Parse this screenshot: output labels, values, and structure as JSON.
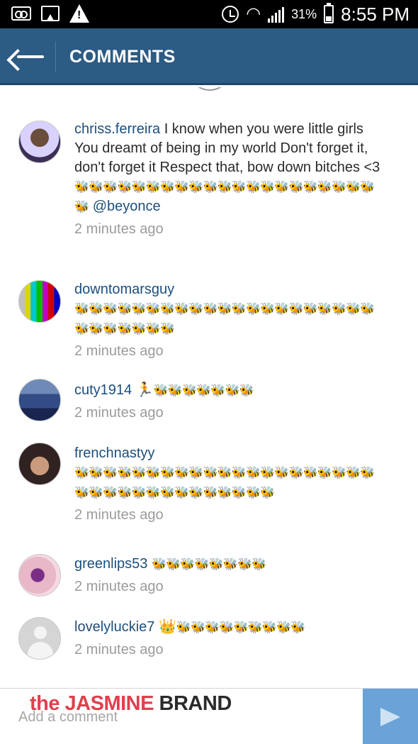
{
  "status_bar": {
    "battery_percent": "31%",
    "time": "8:55 PM",
    "icons": [
      "voicemail-icon",
      "image-icon",
      "warning-icon",
      "alarm-icon",
      "wifi-icon",
      "signal-icon",
      "battery-icon"
    ]
  },
  "header": {
    "title": "COMMENTS",
    "back_icon": "back-arrow-icon",
    "background_color": "#2c5b83"
  },
  "comments": [
    {
      "username": "chriss.ferreira",
      "text": " I know when you were little girls  You dreamt of being in my world Don't forget it, don't forget it  Respect that, bow down bitches <3",
      "emojis": "🐝🐝🐝🐝🐝🐝🐝🐝🐝🐝🐝🐝🐝🐝🐝🐝🐝🐝🐝🐝🐝🐝",
      "mention": "@beyonce",
      "time": "2 minutes ago"
    },
    {
      "username": "downtomarsguy",
      "text": "",
      "emojis": "🐝🐝🐝🐝🐝🐝🐝🐝🐝🐝🐝🐝🐝🐝🐝🐝🐝🐝🐝🐝🐝🐝🐝🐝🐝🐝🐝🐝",
      "mention": "",
      "time": "2 minutes ago"
    },
    {
      "username": "cuty1914",
      "text": " 🏃",
      "emojis": "🐝🐝🐝🐝🐝🐝🐝",
      "mention": "",
      "time": "2 minutes ago"
    },
    {
      "username": "frenchnastyy",
      "text": "",
      "emojis": "🐝🐝🐝🐝🐝🐝🐝🐝🐝🐝🐝🐝🐝🐝🐝🐝🐝🐝🐝🐝🐝🐝🐝🐝🐝🐝🐝🐝🐝🐝🐝🐝🐝🐝🐝",
      "mention": "",
      "time": "2 minutes ago"
    },
    {
      "username": "greenlips53",
      "text": " ",
      "emojis": "🐝🐝🐝🐝🐝🐝🐝🐝",
      "mention": "",
      "time": "2 minutes ago"
    },
    {
      "username": "lovelyluckie7",
      "text": " 👑",
      "emojis": "🐝🐝🐝🐝🐝🐝🐝🐝🐝",
      "mention": "",
      "time": "2 minutes ago"
    }
  ],
  "comment_input": {
    "placeholder": "Add a comment"
  },
  "send_icon": "send-icon",
  "watermark": {
    "part1": "the JASMINE",
    "part2": " BRAND"
  },
  "colors": {
    "username": "#1c4f7d",
    "timestamp": "#9b9b9b",
    "send_button": "#6aa3d8",
    "watermark_red": "#e0404e"
  }
}
